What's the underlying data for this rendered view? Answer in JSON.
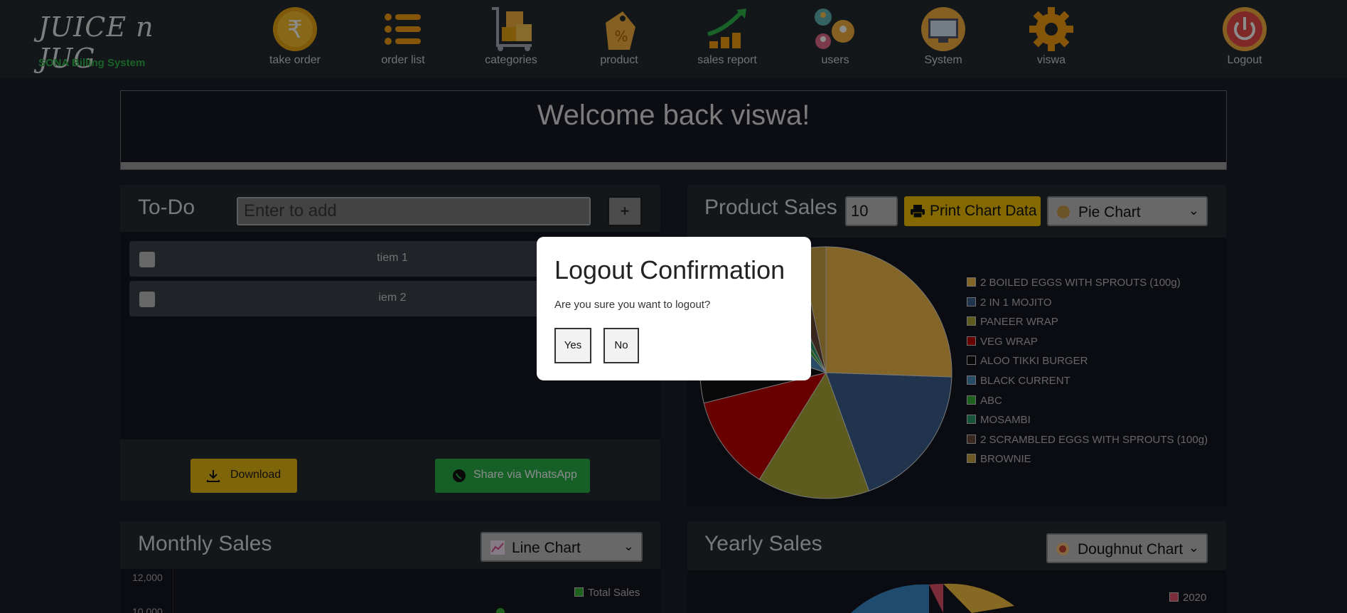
{
  "brand": {
    "logo_text": "JUICE n JUG",
    "subtitle": "SONA Billing System"
  },
  "nav": [
    {
      "label": "take order",
      "icon": "rupee-coin-icon"
    },
    {
      "label": "order list",
      "icon": "list-icon"
    },
    {
      "label": "categories",
      "icon": "cart-boxes-icon"
    },
    {
      "label": "product",
      "icon": "price-tag-icon"
    },
    {
      "label": "sales report",
      "icon": "growth-chart-icon"
    },
    {
      "label": "users",
      "icon": "users-gears-icon"
    },
    {
      "label": "System",
      "icon": "system-monitor-icon"
    },
    {
      "label": "viswa",
      "icon": "gear-icon"
    },
    {
      "label": "Logout",
      "icon": "power-icon"
    }
  ],
  "welcome": "Welcome back viswa!",
  "todo": {
    "title": "To-Do",
    "input_placeholder": "Enter to add",
    "add_label": "+",
    "items": [
      "tiem 1",
      "iem 2"
    ],
    "download_label": "Download",
    "share_label": "Share via WhatsApp"
  },
  "product_sales": {
    "title": "Product Sales",
    "count": "10",
    "print_label": "Print Chart Data",
    "chart_type_label": "Pie Chart"
  },
  "monthly_sales": {
    "title": "Monthly Sales",
    "chart_type_label": "Line Chart"
  },
  "yearly_sales": {
    "title": "Yearly Sales",
    "chart_type_label": "Doughnut Chart"
  },
  "modal": {
    "title": "Logout Confirmation",
    "message": "Are you sure you want to logout?",
    "yes_label": "Yes",
    "no_label": "No"
  },
  "colors": {
    "accent_yellow": "#f0c000",
    "whatsapp_green": "#29b04a",
    "brand_green": "#2fb24a"
  },
  "chart_data": [
    {
      "type": "pie",
      "categories": [
        "2 BOILED EGGS WITH SPROUTS (100g)",
        "2 IN 1 MOJITO",
        "PANEER WRAP",
        "VEG WRAP",
        "ALOO TIKKI BURGER",
        "BLACK CURRENT",
        "ABC",
        "MOSAMBI",
        "2 SCRAMBLED EGGS WITH SPROUTS (100g)",
        "BROWNIE"
      ],
      "values": [
        23,
        17,
        13,
        11,
        8,
        8,
        2,
        2,
        3,
        3
      ],
      "colors": [
        "#f0b84a",
        "#3d5f8f",
        "#a9a838",
        "#c00000",
        "#111111",
        "#4a8ab8",
        "#38b038",
        "#2a9a6a",
        "#6a4a3a",
        "#c8a040"
      ],
      "legend": "right"
    },
    {
      "type": "line",
      "series": [
        {
          "name": "Total Sales"
        }
      ],
      "yticks": [
        "12,000",
        "10,000"
      ],
      "legend": "top-right"
    },
    {
      "type": "pie",
      "categories": [
        "2020"
      ],
      "colors": [
        "#e0506a"
      ],
      "legend": "right"
    }
  ]
}
